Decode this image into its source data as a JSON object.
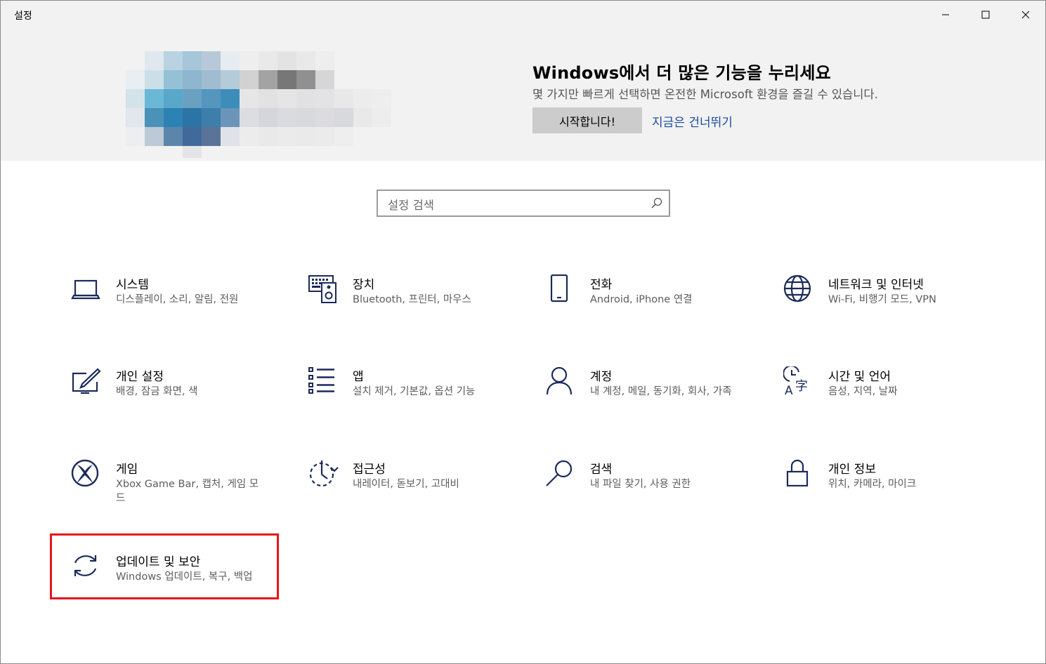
{
  "window": {
    "title": "설정",
    "controls": [
      "minimize-icon",
      "maximize-icon",
      "close-icon"
    ]
  },
  "banner": {
    "title": "Windows에서 더 많은 기능을 누리세요",
    "subtitle": "몇 가지만 빠르게 선택하면 온전한 Microsoft 환경을 즐길 수 있습니다.",
    "start_label": "시작합니다!",
    "skip_label": "지금은 건너뛰기"
  },
  "search": {
    "placeholder": "설정 검색"
  },
  "colors": {
    "icon": "#1b2a5a",
    "link": "#1a4a9a",
    "highlight": "#e8141a",
    "banner_bg": "#f2f2f2"
  },
  "tiles": [
    {
      "icon": "laptop-icon",
      "title": "시스템",
      "subtitle": "디스플레이, 소리, 알림, 전원"
    },
    {
      "icon": "devices-icon",
      "title": "장치",
      "subtitle": "Bluetooth, 프린터, 마우스"
    },
    {
      "icon": "phone-icon",
      "title": "전화",
      "subtitle": "Android, iPhone 연결"
    },
    {
      "icon": "globe-icon",
      "title": "네트워크 및 인터넷",
      "subtitle": "Wi-Fi, 비행기 모드, VPN"
    },
    {
      "icon": "personalization-icon",
      "title": "개인 설정",
      "subtitle": "배경, 잠금 화면, 색"
    },
    {
      "icon": "apps-list-icon",
      "title": "앱",
      "subtitle": "설치 제거, 기본값, 옵션 기능"
    },
    {
      "icon": "person-icon",
      "title": "계정",
      "subtitle": "내 계정, 메일, 동기화, 회사, 가족"
    },
    {
      "icon": "time-language-icon",
      "title": "시간 및 언어",
      "subtitle": "음성, 지역, 날짜"
    },
    {
      "icon": "xbox-icon",
      "title": "게임",
      "subtitle": "Xbox Game Bar, 캡처, 게임 모드"
    },
    {
      "icon": "accessibility-icon",
      "title": "접근성",
      "subtitle": "내레이터, 돋보기, 고대비"
    },
    {
      "icon": "search-icon",
      "title": "검색",
      "subtitle": "내 파일 찾기, 사용 권한"
    },
    {
      "icon": "lock-icon",
      "title": "개인 정보",
      "subtitle": "위치, 카메라, 마이크"
    },
    {
      "icon": "update-sync-icon",
      "title": "업데이트 및 보안",
      "subtitle": "Windows 업데이트, 복구, 백업"
    }
  ]
}
